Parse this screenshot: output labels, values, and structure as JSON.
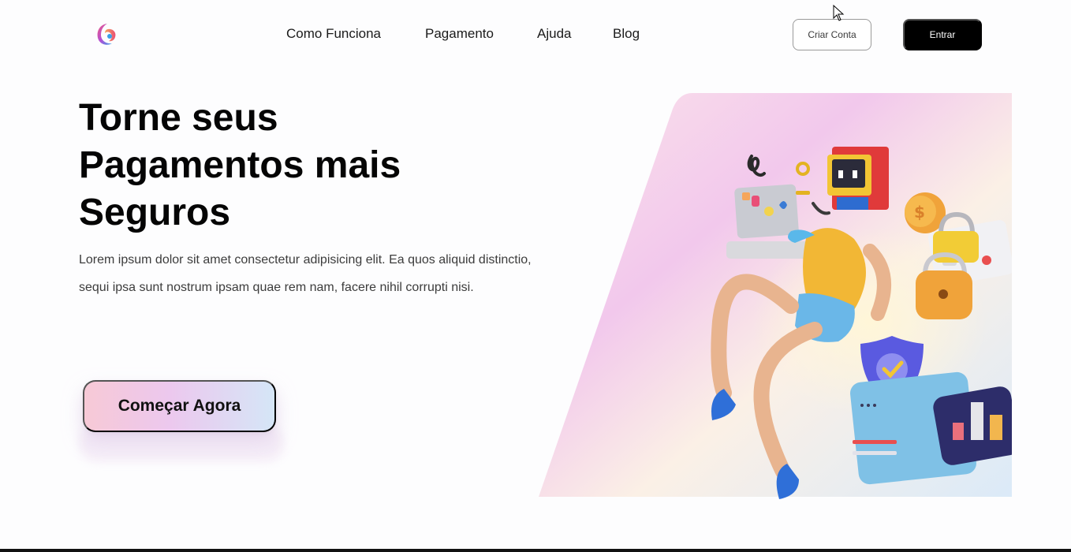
{
  "nav": {
    "links": [
      "Como Funciona",
      "Pagamento",
      "Ajuda",
      "Blog"
    ],
    "create_account": "Criar Conta",
    "login": "Entrar"
  },
  "hero": {
    "title_lines": [
      "Torne seus",
      "Pagamentos mais",
      "Seguros"
    ],
    "description": "Lorem ipsum dolor sit amet consectetur adipisicing elit. Ea quos aliquid distinctio, sequi ipsa sunt nostrum ipsam quae rem nam, facere nihil corrupti nisi.",
    "cta_label": "Começar Agora"
  },
  "colors": {
    "primary_button": "#000000",
    "cta_gradient_start": "#f7c9d6",
    "cta_gradient_end": "#d5e6f7"
  },
  "icons": {
    "logo": "swirl-logo-icon",
    "cursor": "mouse-pointer-icon"
  }
}
